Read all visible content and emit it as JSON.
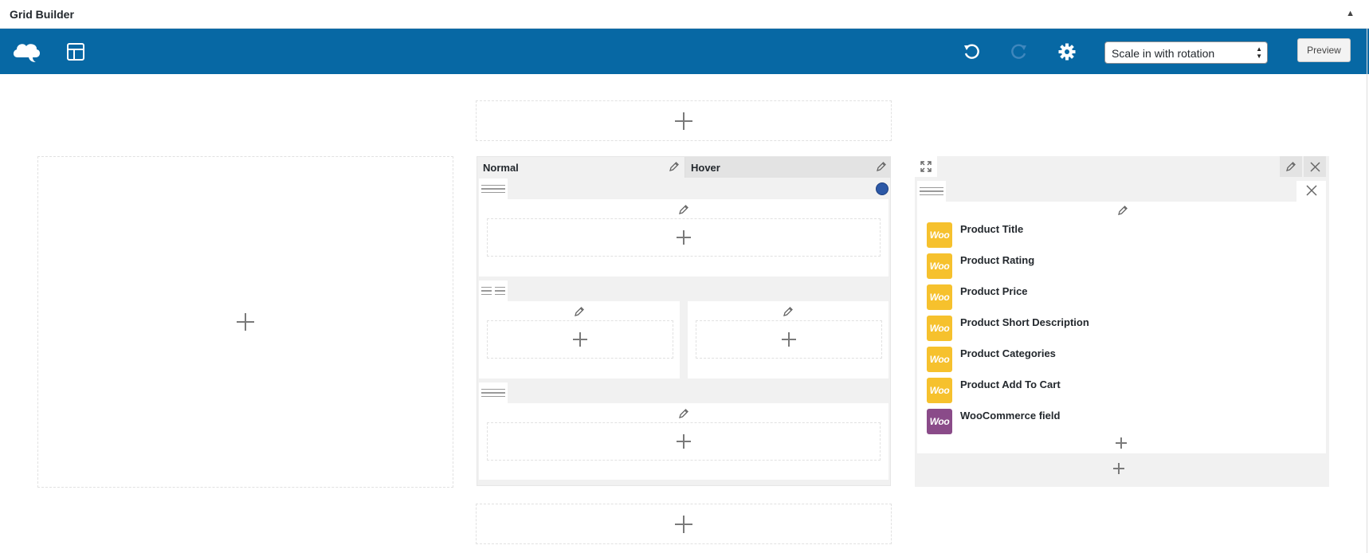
{
  "app": {
    "title": "Grid Builder",
    "collapse_glyph": "▲"
  },
  "toolbar": {
    "logo_icon": "cloud-logo-icon",
    "layout_icon": "layout-icon",
    "undo_icon": "undo-icon",
    "redo_icon": "redo-icon",
    "settings_icon": "gear-icon",
    "animation_select": {
      "value": "Scale in with rotation"
    },
    "preview_label": "Preview",
    "accent_color": "#0768a4"
  },
  "middle_panel": {
    "tabs": [
      {
        "label": "Normal"
      },
      {
        "label": "Hover"
      }
    ],
    "status_color": "#2c58a6"
  },
  "right_panel": {
    "elements": [
      {
        "icon_text": "Woo",
        "label": "Product Title",
        "color": "#f6c12d"
      },
      {
        "icon_text": "Woo",
        "label": "Product Rating",
        "color": "#f6c12d"
      },
      {
        "icon_text": "Woo",
        "label": "Product Price",
        "color": "#f6c12d"
      },
      {
        "icon_text": "Woo",
        "label": "Product Short Description",
        "color": "#f6c12d"
      },
      {
        "icon_text": "Woo",
        "label": "Product Categories",
        "color": "#f6c12d"
      },
      {
        "icon_text": "Woo",
        "label": "Product Add To Cart",
        "color": "#f6c12d"
      },
      {
        "icon_text": "Woo",
        "label": "WooCommerce field",
        "color": "#8a4b89"
      }
    ]
  }
}
